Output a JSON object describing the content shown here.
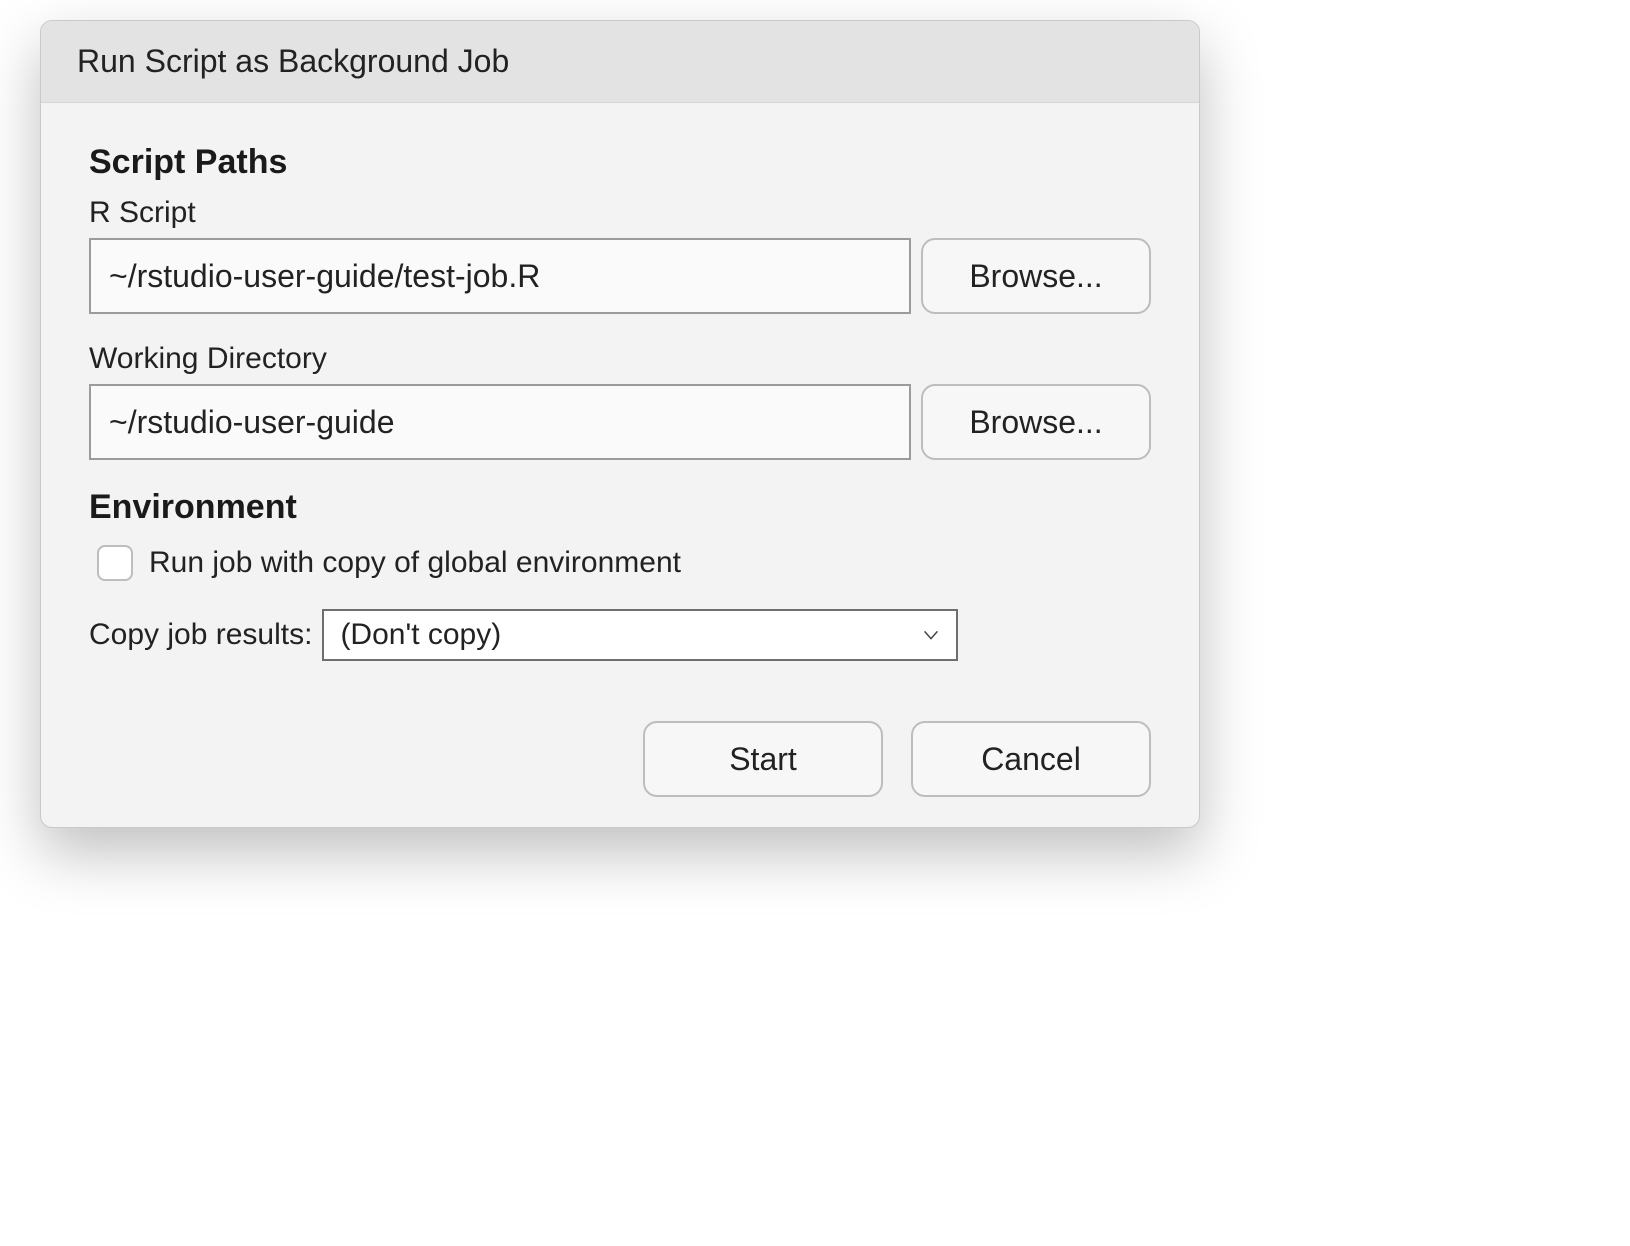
{
  "dialog": {
    "title": "Run Script as Background Job"
  },
  "sections": {
    "script_paths": "Script Paths",
    "environment": "Environment"
  },
  "fields": {
    "r_script": {
      "label": "R Script",
      "value": "~/rstudio-user-guide/test-job.R",
      "browse": "Browse..."
    },
    "working_dir": {
      "label": "Working Directory",
      "value": "~/rstudio-user-guide",
      "browse": "Browse..."
    }
  },
  "env": {
    "copy_global_checkbox": {
      "checked": false,
      "label": "Run job with copy of global environment"
    },
    "copy_results": {
      "label": "Copy job results:",
      "selected": "(Don't copy)"
    }
  },
  "buttons": {
    "start": "Start",
    "cancel": "Cancel"
  }
}
